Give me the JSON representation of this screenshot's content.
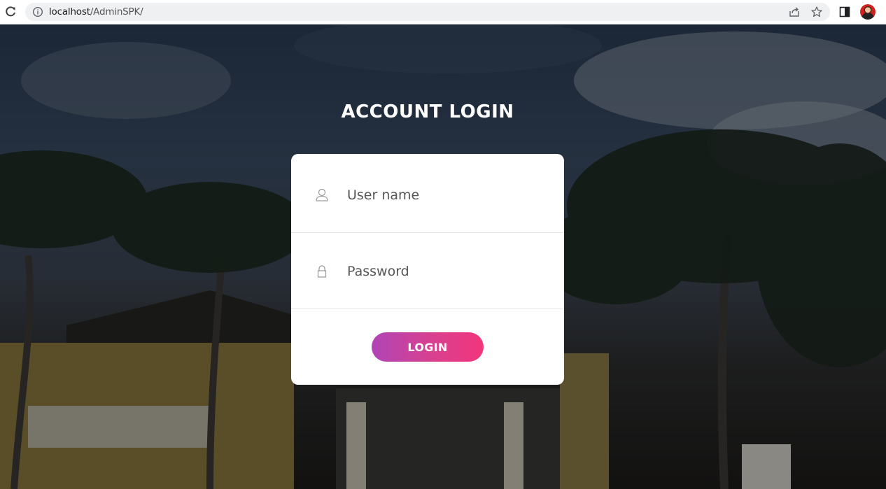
{
  "browser": {
    "url_host": "localhost",
    "url_path": "/AdminSPK/",
    "icons": [
      "reload-icon",
      "info-icon",
      "share-icon",
      "bookmark-star-icon",
      "side-panel-icon",
      "profile-avatar"
    ]
  },
  "login": {
    "title": "ACCOUNT LOGIN",
    "username_placeholder": "User name",
    "password_placeholder": "Password",
    "button_label": "LOGIN",
    "icons": [
      "user-icon",
      "lock-icon"
    ]
  },
  "colors": {
    "button_gradient_start": "#b045b6",
    "button_gradient_end": "#f2357b",
    "card_background": "#ffffff"
  }
}
